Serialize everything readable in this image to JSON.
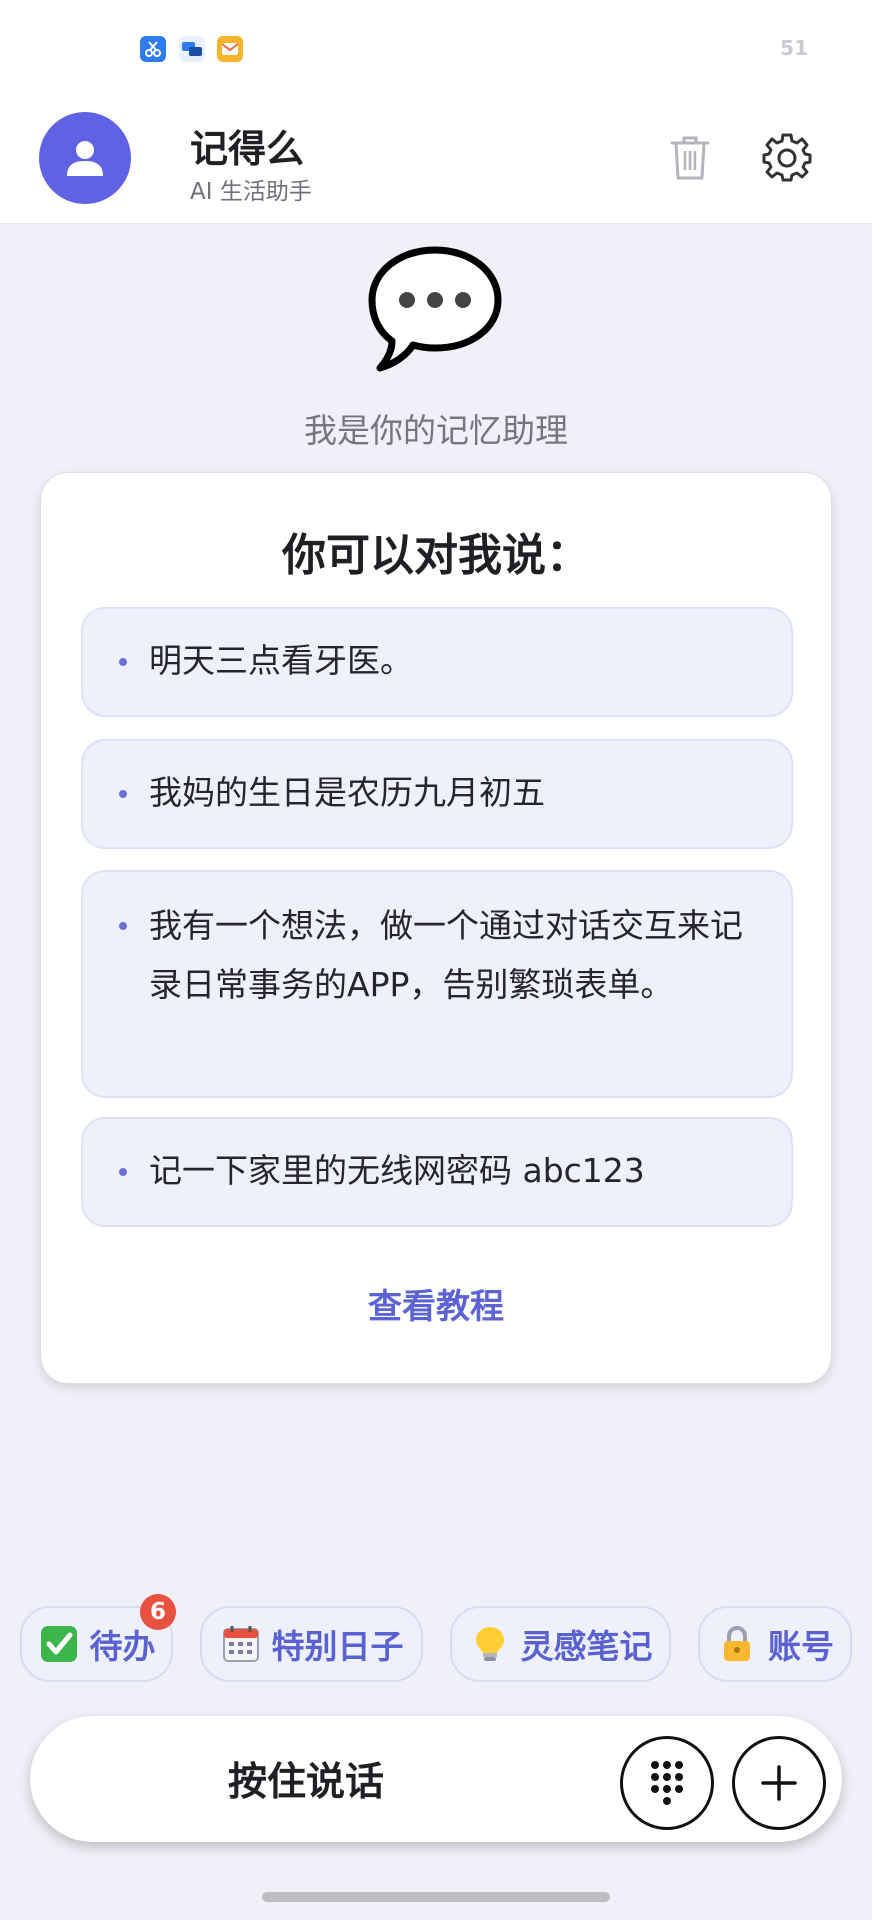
{
  "status_bar": {
    "time_or_number": "51",
    "notification_icons": [
      "scissors-app-icon",
      "chat-bubbles-icon",
      "mail-icon"
    ]
  },
  "header": {
    "title": "记得么",
    "subtitle": "AI 生活助手",
    "avatar_icon": "user-icon",
    "actions": [
      "trash-icon",
      "gear-icon"
    ]
  },
  "hero": {
    "icon": "speech-bubble-icon",
    "tagline": "我是你的记忆助理"
  },
  "card": {
    "title": "你可以对我说：",
    "examples": [
      "明天三点看牙医。",
      "我妈的生日是农历九月初五",
      "我有一个想法，做一个通过对话交互来记录日常事务的APP，告别繁琐表单。",
      "记一下家里的无线网密码 abc123"
    ],
    "tutorial_link": "查看教程"
  },
  "chips": [
    {
      "label": "待办",
      "icon": "check-mark-icon",
      "badge": "6"
    },
    {
      "label": "特别日子",
      "icon": "calendar-icon"
    },
    {
      "label": "灵感笔记",
      "icon": "lightbulb-icon"
    },
    {
      "label": "账号",
      "icon": "lock-icon"
    }
  ],
  "bottom_bar": {
    "voice_label": "按住说话",
    "buttons": [
      "keypad-icon",
      "plus-icon"
    ]
  },
  "colors": {
    "accent": "#5f63e3",
    "chip_text": "#5a62cf",
    "badge": "#e8503f",
    "card_item_bg": "#eef0fc",
    "page_bg": "#f0f0f8"
  }
}
